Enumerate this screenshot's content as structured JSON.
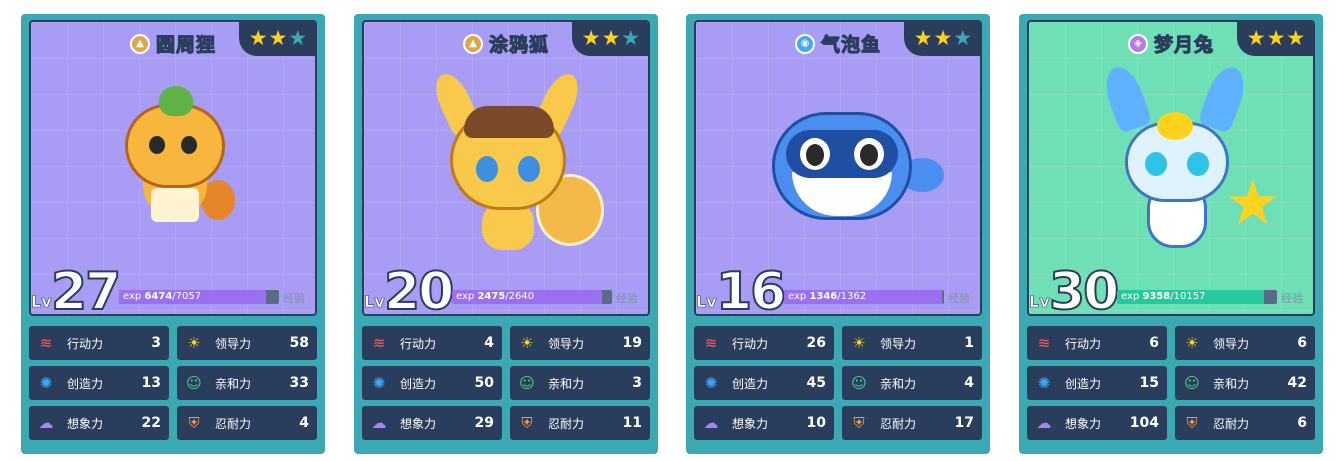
{
  "stat_labels": {
    "action": "行动力",
    "leadership": "领导力",
    "creativity": "创造力",
    "affinity": "亲和力",
    "imagination": "想象力",
    "endurance": "忍耐力"
  },
  "exp_word": "经验",
  "lv_label": "Lv",
  "exp_prefix": "exp",
  "cards": [
    {
      "name": "圆周狸",
      "element_icon": "mountain-icon",
      "stars": 2,
      "max_stars": 3,
      "level": "27",
      "exp_current": "6474",
      "exp_sep_max": "/7057",
      "exp_fraction": 0.917,
      "stats": {
        "action": "3",
        "leadership": "58",
        "creativity": "13",
        "affinity": "33",
        "imagination": "22",
        "endurance": "4"
      }
    },
    {
      "name": "涂鸦狐",
      "element_icon": "mountain-icon",
      "stars": 2,
      "max_stars": 3,
      "level": "20",
      "exp_current": "2475",
      "exp_sep_max": "/2640",
      "exp_fraction": 0.9375,
      "stats": {
        "action": "4",
        "leadership": "19",
        "creativity": "50",
        "affinity": "3",
        "imagination": "29",
        "endurance": "11"
      }
    },
    {
      "name": "气泡鱼",
      "element_icon": "water-swirl-icon",
      "stars": 2,
      "max_stars": 3,
      "level": "16",
      "exp_current": "1346",
      "exp_sep_max": "/1362",
      "exp_fraction": 0.988,
      "stats": {
        "action": "26",
        "leadership": "1",
        "creativity": "45",
        "affinity": "4",
        "imagination": "10",
        "endurance": "17"
      }
    },
    {
      "name": "梦月兔",
      "element_icon": "spirit-icon",
      "stars": 3,
      "max_stars": 3,
      "level": "30",
      "exp_current": "9358",
      "exp_sep_max": "/10157",
      "exp_fraction": 0.921,
      "stats": {
        "action": "6",
        "leadership": "6",
        "creativity": "15",
        "affinity": "42",
        "imagination": "104",
        "endurance": "6"
      }
    }
  ],
  "colors": {
    "card_frame": "#3aa9b3",
    "art_purple": "#a89cf5",
    "art_green": "#6fe0b6",
    "panel_dark": "#2a3d5c",
    "star_gold": "#ffd21e",
    "exp_purple": "#9a6ff0",
    "exp_green": "#25c99a"
  }
}
